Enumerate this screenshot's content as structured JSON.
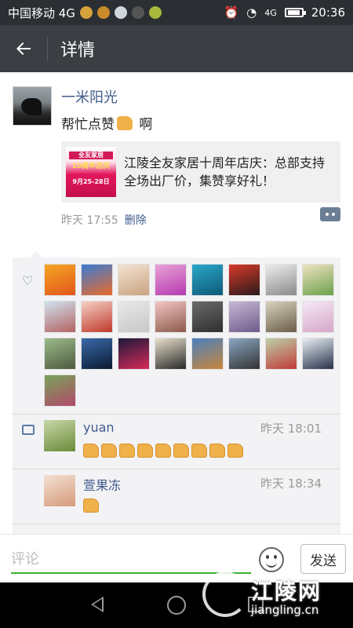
{
  "status_bar": {
    "carrier": "中国移动 4G",
    "network": "4G",
    "time": "20:36"
  },
  "title_bar": {
    "back_icon": "arrow-left-icon",
    "title": "详情"
  },
  "post": {
    "author": "一米阳光",
    "text_before": "帮忙点赞",
    "text_after": " 啊",
    "share": {
      "thumb_line1": "全友家居",
      "thumb_line2": "10周年店庆",
      "thumb_line3": "9月25-28日",
      "title": "江陵全友家居十周年店庆：总部支持全场出厂价，集赞享好礼！"
    },
    "time": "昨天 17:55",
    "delete_label": "删除"
  },
  "likes": {
    "icon": "heart-icon",
    "avatars": [
      {
        "name": "like-avatar",
        "color1": "#f5a623",
        "color2": "#e2561b"
      },
      {
        "name": "like-avatar",
        "color1": "#3a7bd5",
        "color2": "#e96b2b"
      },
      {
        "name": "like-avatar",
        "color1": "#f3e4d4",
        "color2": "#c9a27e"
      },
      {
        "name": "like-avatar",
        "color1": "#e9a3d7",
        "color2": "#b53ab0"
      },
      {
        "name": "like-avatar",
        "color1": "#2aa7c9",
        "color2": "#0e5a78"
      },
      {
        "name": "like-avatar",
        "color1": "#d93a2a",
        "color2": "#2b1a1a"
      },
      {
        "name": "like-avatar",
        "color1": "#eeeeee",
        "color2": "#8a8a8a"
      },
      {
        "name": "like-avatar",
        "color1": "#f0e3c2",
        "color2": "#6aa04a"
      },
      {
        "name": "like-avatar",
        "color1": "#cfe3f0",
        "color2": "#b46262"
      },
      {
        "name": "like-avatar",
        "color1": "#f5d0c5",
        "color2": "#c0392b"
      },
      {
        "name": "like-avatar",
        "color1": "#e8e8e8",
        "color2": "#c8c8c8"
      },
      {
        "name": "like-avatar",
        "color1": "#f3c6c6",
        "color2": "#8c5a4a"
      },
      {
        "name": "like-avatar",
        "color1": "#6b6b6b",
        "color2": "#2e2e2e"
      },
      {
        "name": "like-avatar",
        "color1": "#c9b8d6",
        "color2": "#6e5a8a"
      },
      {
        "name": "like-avatar",
        "color1": "#d8d2bf",
        "color2": "#6b5e48"
      },
      {
        "name": "like-avatar",
        "color1": "#f4e9f5",
        "color2": "#d7a6c9"
      },
      {
        "name": "like-avatar",
        "color1": "#9dbb8a",
        "color2": "#4c5a3f"
      },
      {
        "name": "like-avatar",
        "color1": "#3b6aa8",
        "color2": "#0a1a33"
      },
      {
        "name": "like-avatar",
        "color1": "#1a1a3a",
        "color2": "#d82a5a"
      },
      {
        "name": "like-avatar",
        "color1": "#e8e0cc",
        "color2": "#2a2a2a"
      },
      {
        "name": "like-avatar",
        "color1": "#4a7fc0",
        "color2": "#c9873a"
      },
      {
        "name": "like-avatar",
        "color1": "#8aa6c2",
        "color2": "#333333"
      },
      {
        "name": "like-avatar",
        "color1": "#bcd1a8",
        "color2": "#c23a3a"
      },
      {
        "name": "like-avatar",
        "color1": "#e8eef4",
        "color2": "#27334a"
      },
      {
        "name": "like-avatar",
        "color1": "#7aa35a",
        "color2": "#b04a6a"
      }
    ]
  },
  "comments": [
    {
      "name": "yuan",
      "time": "昨天 18:01",
      "thumbs": 9,
      "avatar_c1": "#c7d8a8",
      "avatar_c2": "#6b8a3a"
    },
    {
      "name": "萱果冻",
      "time": "昨天 18:34",
      "thumbs": 1,
      "avatar_c1": "#f3e0d4",
      "avatar_c2": "#d59b7a"
    }
  ],
  "input": {
    "placeholder": "评论",
    "send_label": "发送",
    "emoji_icon": "smiley-icon"
  },
  "watermark": {
    "text": "江陵网",
    "url": "jiangling.cn"
  }
}
